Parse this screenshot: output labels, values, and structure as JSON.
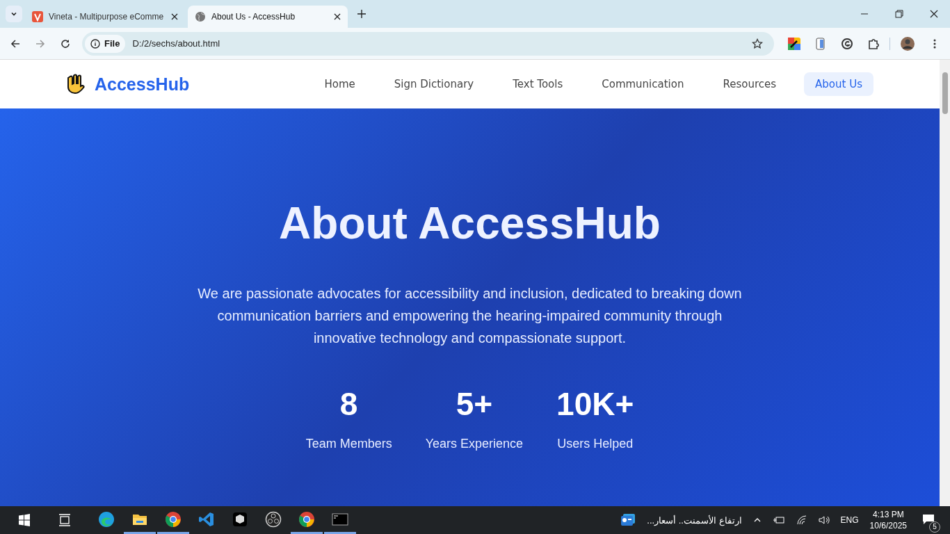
{
  "browser": {
    "tabs": [
      {
        "title": "Vineta - Multipurpose eComme",
        "kind": "brand",
        "selected": false
      },
      {
        "title": "About Us - AccessHub",
        "kind": "globe",
        "selected": true
      }
    ],
    "address": {
      "scheme": "File",
      "url": "D:/2/sechs/about.html"
    }
  },
  "site": {
    "logo": "AccessHub",
    "nav": [
      {
        "label": "Home",
        "selected": false
      },
      {
        "label": "Sign Dictionary",
        "selected": false
      },
      {
        "label": "Text Tools",
        "selected": false
      },
      {
        "label": "Communication",
        "selected": false
      },
      {
        "label": "Resources",
        "selected": false
      },
      {
        "label": "About Us",
        "selected": true
      }
    ],
    "hero": {
      "title": "About AccessHub",
      "text": "We are passionate advocates for accessibility and inclusion, dedicated to breaking down communication barriers and empowering the hearing-impaired community through innovative technology and compassionate support.",
      "stats": [
        {
          "value": "8",
          "label": "Team Members"
        },
        {
          "value": "5+",
          "label": "Years Experience"
        },
        {
          "value": "10K+",
          "label": "Users Helped"
        }
      ]
    }
  },
  "taskbar": {
    "apps": [
      {
        "kind": "edge",
        "running": false
      },
      {
        "kind": "folder",
        "running": true
      },
      {
        "kind": "chrome",
        "running": true
      },
      {
        "kind": "vscode",
        "running": false
      },
      {
        "kind": "cube",
        "running": false
      },
      {
        "kind": "obs",
        "running": false
      },
      {
        "kind": "chrome",
        "running": true
      },
      {
        "kind": "terminal",
        "running": true
      }
    ],
    "news": "ارتفاع الأسمنت.. أسعار...",
    "language": "ENG",
    "time": "4:13 PM",
    "date": "10/6/2025",
    "notifications": "5"
  }
}
